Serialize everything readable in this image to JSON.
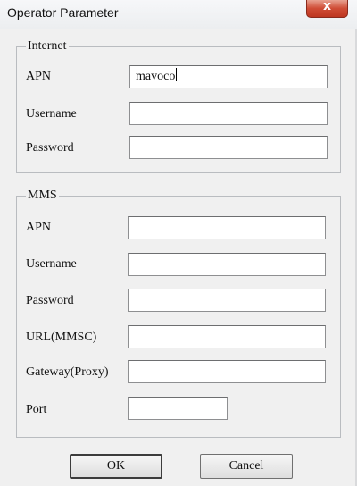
{
  "window": {
    "title": "Operator Parameter",
    "close_glyph": "x"
  },
  "internet": {
    "legend": "Internet",
    "apn_label": "APN",
    "apn_value": "mavoco",
    "username_label": "Username",
    "username_value": "",
    "password_label": "Password",
    "password_value": ""
  },
  "mms": {
    "legend": "MMS",
    "apn_label": "APN",
    "apn_value": "",
    "username_label": "Username",
    "username_value": "",
    "password_label": "Password",
    "password_value": "",
    "url_label": "URL(MMSC)",
    "url_value": "",
    "gateway_label": "Gateway(Proxy)",
    "gateway_value": "",
    "port_label": "Port",
    "port_value": ""
  },
  "buttons": {
    "ok_label": "OK",
    "cancel_label": "Cancel"
  },
  "icons": {
    "close": "close-icon"
  }
}
